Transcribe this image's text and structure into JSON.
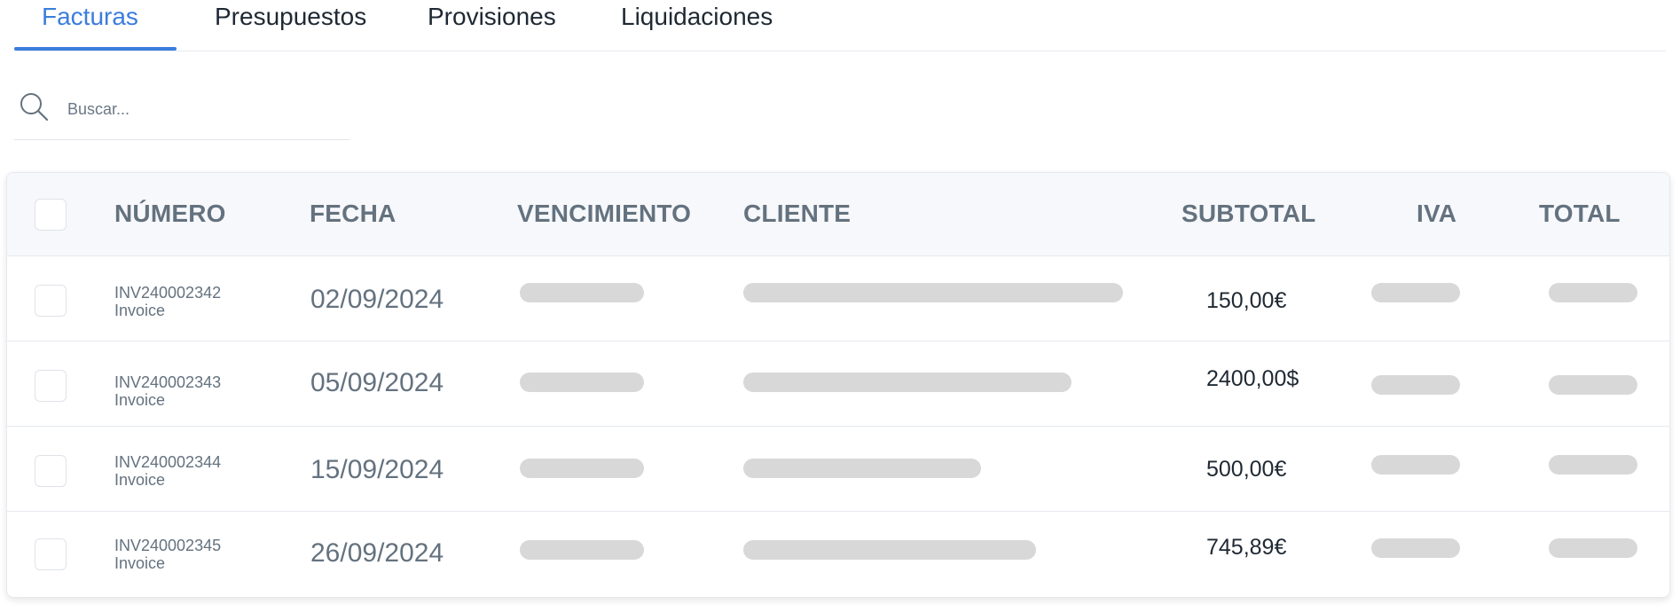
{
  "tabs": [
    {
      "label": "Facturas",
      "active": true
    },
    {
      "label": "Presupuestos",
      "active": false
    },
    {
      "label": "Provisiones",
      "active": false
    },
    {
      "label": "Liquidaciones",
      "active": false
    }
  ],
  "search": {
    "placeholder": "Buscar...",
    "value": ""
  },
  "table": {
    "columns": {
      "numero": "NÚMERO",
      "fecha": "FECHA",
      "vencimiento": "VENCIMIENTO",
      "cliente": "CLIENTE",
      "subtotal": "SUBTOTAL",
      "iva": "IVA",
      "total": "TOTAL"
    },
    "rows": [
      {
        "numero": "INV240002342",
        "tipo": "Invoice",
        "fecha": "02/09/2024",
        "subtotal": "150,00€"
      },
      {
        "numero": "INV240002343",
        "tipo": "Invoice",
        "fecha": "05/09/2024",
        "subtotal": "2400,00$"
      },
      {
        "numero": "INV240002344",
        "tipo": "Invoice",
        "fecha": "15/09/2024",
        "subtotal": "500,00€"
      },
      {
        "numero": "INV240002345",
        "tipo": "Invoice",
        "fecha": "26/09/2024",
        "subtotal": "745,89€"
      }
    ]
  },
  "colors": {
    "accent": "#3b7ddd",
    "header_text": "#64727f",
    "skeleton": "#d8d8d8"
  },
  "icons": {
    "search": "search-icon"
  }
}
